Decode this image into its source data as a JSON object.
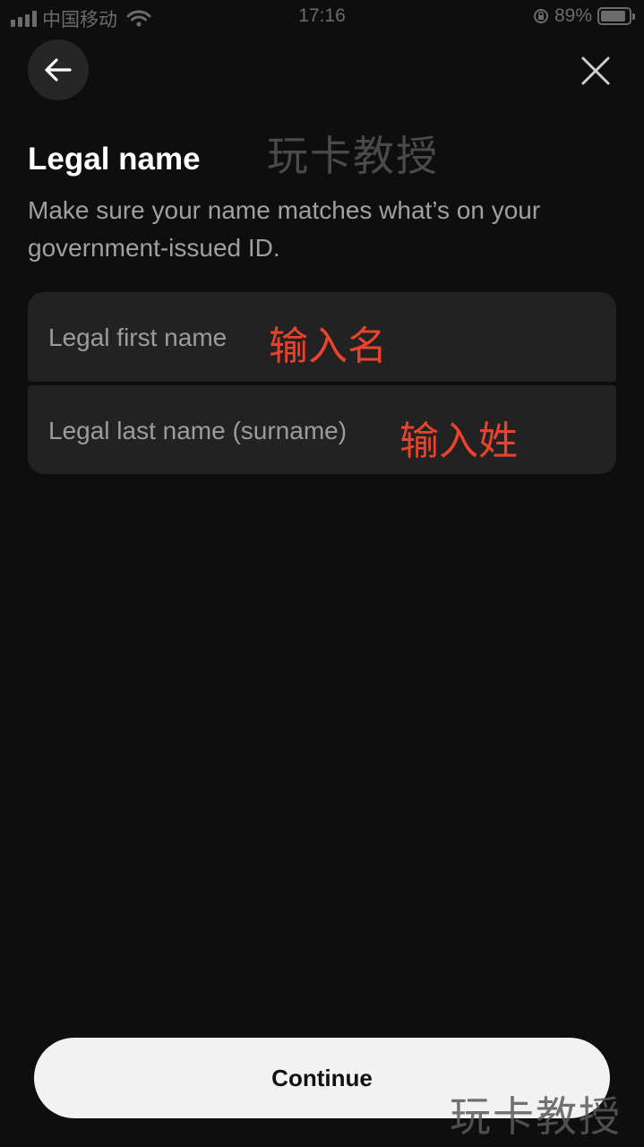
{
  "status_bar": {
    "carrier": "中国移动",
    "time": "17:16",
    "battery": "89%",
    "battery_level": 0.89
  },
  "nav": {
    "back_icon": "arrow-left-icon",
    "close_icon": "close-icon"
  },
  "watermark": {
    "top": "玩卡教授",
    "bottom": "玩卡教授"
  },
  "page": {
    "title": "Legal name",
    "subtitle": "Make sure your name matches what’s on your government-issued ID."
  },
  "form": {
    "first_name": {
      "placeholder": "Legal first name",
      "value": "",
      "annotation": "输入名"
    },
    "last_name": {
      "placeholder": "Legal last name (surname)",
      "value": "",
      "annotation": "输入姓"
    }
  },
  "actions": {
    "continue_label": "Continue"
  },
  "colors": {
    "background": "#0e0e0e",
    "field_bg": "#222222",
    "annotation": "#e8432c",
    "button_bg": "#f2f2f2"
  }
}
